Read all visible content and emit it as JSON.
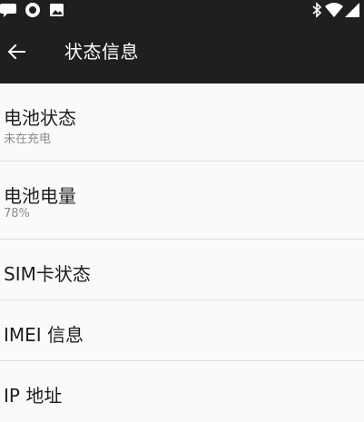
{
  "status_bar": {
    "left_icons": [
      "chat-bubble-icon",
      "record-icon",
      "image-icon"
    ],
    "right_icons": [
      "bluetooth-icon",
      "wifi-icon",
      "cellular-signal-icon"
    ]
  },
  "toolbar": {
    "back_icon": "arrow-left-icon",
    "title": "状态信息"
  },
  "items": [
    {
      "title": "电池状态",
      "subtitle": "未在充电"
    },
    {
      "title": "电池电量",
      "subtitle": "78%"
    },
    {
      "title": "SIM卡状态"
    },
    {
      "title": "IMEI 信息"
    },
    {
      "title": "IP 地址"
    }
  ],
  "colors": {
    "toolbar_bg": "#1f1f1f",
    "page_bg": "#fafafa",
    "title_text": "#1e1e1e",
    "subtitle_text": "#8a8a8a",
    "divider": "#e0e0e0"
  }
}
